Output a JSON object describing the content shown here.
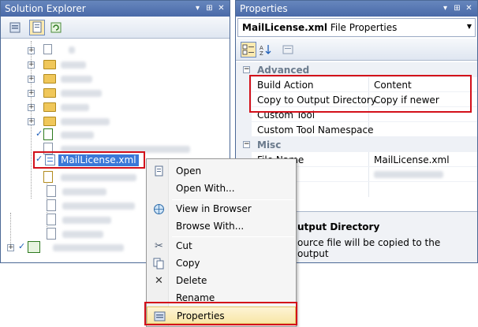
{
  "solution_explorer": {
    "title": "Solution Explorer",
    "selected_file": "MailLicense.xml"
  },
  "properties": {
    "title": "Properties",
    "object_name": "MailLicense.xml",
    "object_type": "File Properties",
    "categories": [
      {
        "name": "Advanced",
        "rows": [
          {
            "name": "Build Action",
            "value": "Content"
          },
          {
            "name": "Copy to Output Directory",
            "value": "Copy if newer"
          },
          {
            "name": "Custom Tool",
            "value": ""
          },
          {
            "name": "Custom Tool Namespace",
            "value": ""
          }
        ]
      },
      {
        "name": "Misc",
        "rows": [
          {
            "name": "File Name",
            "value": "MailLicense.xml"
          }
        ]
      }
    ],
    "description_title": "utput Directory",
    "description_text": "ource file will be copied to the output"
  },
  "context_menu": {
    "items": [
      "Open",
      "Open With...",
      "View in Browser",
      "Browse With...",
      "Cut",
      "Copy",
      "Delete",
      "Rename",
      "Properties"
    ]
  },
  "colors": {
    "titlebar": "#4a6aa8",
    "highlight_box": "#d3101a",
    "selection": "#3a78d8"
  }
}
